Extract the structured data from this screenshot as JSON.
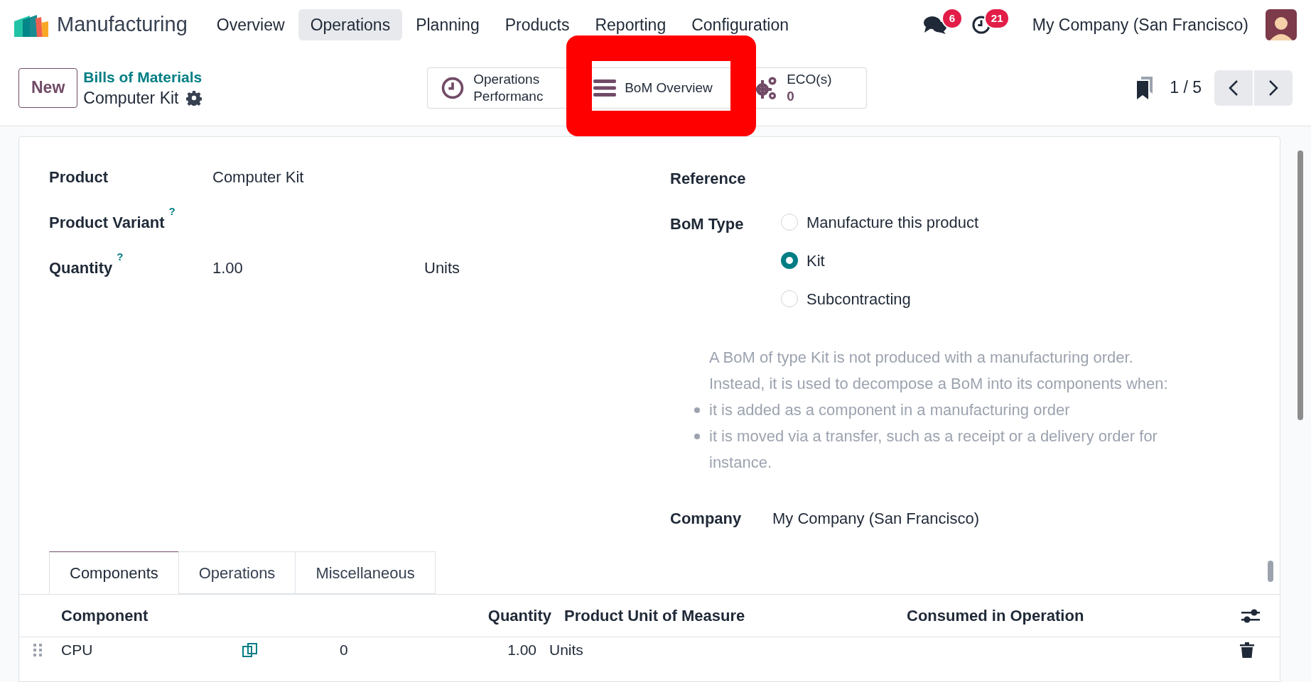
{
  "app": {
    "name": "Manufacturing"
  },
  "menu": [
    {
      "label": "Overview",
      "selected": false
    },
    {
      "label": "Operations",
      "selected": true
    },
    {
      "label": "Planning",
      "selected": false
    },
    {
      "label": "Products",
      "selected": false
    },
    {
      "label": "Reporting",
      "selected": false
    },
    {
      "label": "Configuration",
      "selected": false
    }
  ],
  "systray": {
    "messages_count": "6",
    "activities_count": "21",
    "company": "My Company (San Francisco)"
  },
  "control_panel": {
    "new_button": "New",
    "breadcrumb": "Bills of Materials",
    "record_title": "Computer Kit",
    "smart_buttons": [
      {
        "kind": "clock",
        "label": "Operations",
        "label_2": "Performanc"
      },
      {
        "kind": "list",
        "label": "BoM Overview"
      },
      {
        "kind": "gears",
        "label": "ECO(s)",
        "value": "0"
      }
    ],
    "pager": "1 / 5"
  },
  "form": {
    "fields_left": [
      {
        "label": "Product",
        "value": "Computer Kit"
      },
      {
        "label": "Product Variant",
        "help_mark": "?"
      },
      {
        "label": "Quantity",
        "help_mark": "?",
        "value": "1.00",
        "unit": "Units"
      }
    ],
    "reference_label": "Reference",
    "bom_type": {
      "label": "BoM Type",
      "options": [
        {
          "label": "Manufacture this product",
          "selected": false
        },
        {
          "label": "Kit",
          "selected": true
        },
        {
          "label": "Subcontracting",
          "selected": false
        }
      ]
    },
    "help_text": {
      "intro": "A BoM of type Kit is not produced with a manufacturing order. Instead, it is used to decompose a BoM into its components when:",
      "bullets": [
        "it is added as a component in a manufacturing order",
        "it is moved via a transfer, such as a receipt or a delivery order for instance."
      ]
    },
    "company": {
      "label": "Company",
      "value": "My Company (San Francisco)"
    }
  },
  "tabs": [
    {
      "label": "Components",
      "selected": true
    },
    {
      "label": "Operations",
      "selected": false
    },
    {
      "label": "Miscellaneous",
      "selected": false
    }
  ],
  "table": {
    "columns": [
      "Component",
      "Quantity",
      "Product Unit of Measure",
      "Consumed in Operation"
    ],
    "rows": [
      {
        "component": "CPU",
        "column_2": "0",
        "quantity": "1.00",
        "unit": "Units"
      }
    ]
  }
}
